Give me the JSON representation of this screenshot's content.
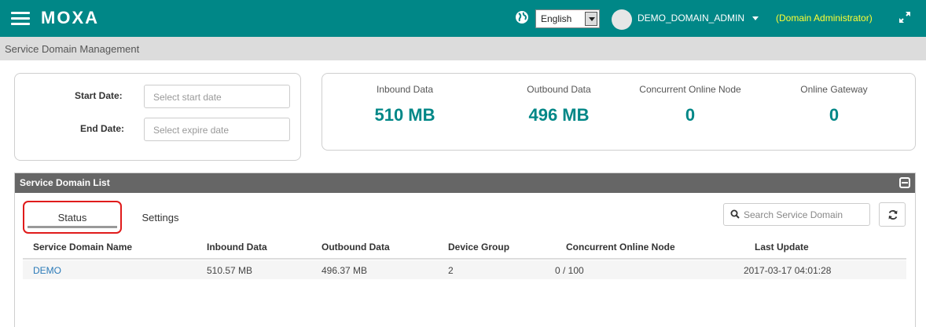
{
  "header": {
    "logo": "MOXA",
    "language": "English",
    "user": "DEMO_DOMAIN_ADMIN",
    "role": "(Domain Administrator)",
    "colors": {
      "bar": "#008787",
      "role": "#ffff33"
    }
  },
  "breadcrumb": "Service Domain Management",
  "date_filter": {
    "start_label": "Start Date:",
    "start_placeholder": "Select start date",
    "end_label": "End Date:",
    "end_placeholder": "Select expire date"
  },
  "stats": [
    {
      "label": "Inbound Data",
      "value": "510 MB"
    },
    {
      "label": "Outbound Data",
      "value": "496 MB"
    },
    {
      "label": "Concurrent Online Node",
      "value": "0"
    },
    {
      "label": "Online Gateway",
      "value": "0"
    }
  ],
  "list": {
    "title": "Service Domain List",
    "tabs": [
      {
        "label": "Status",
        "active": true
      },
      {
        "label": "Settings",
        "active": false
      }
    ],
    "search_placeholder": "Search Service Domain",
    "columns": [
      "Service Domain Name",
      "Inbound Data",
      "Outbound Data",
      "Device Group",
      "Concurrent Online Node",
      "Last Update"
    ],
    "rows": [
      [
        "DEMO",
        "510.57 MB",
        "496.37 MB",
        "2",
        "0 / 100",
        "2017-03-17 04:01:28"
      ]
    ]
  },
  "icons": [
    "menu-icon",
    "globe-icon",
    "chevron-down-icon",
    "expand-icon",
    "collapse-icon",
    "search-icon",
    "refresh-icon"
  ]
}
